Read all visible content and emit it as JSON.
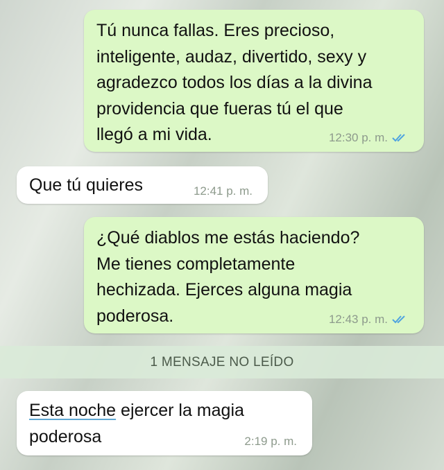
{
  "messages": [
    {
      "direction": "outgoing",
      "text": "Tú nunca fallas. Eres precioso,\ninteligente, audaz, divertido, sexy y\nagradezco todos los días a la divina\nprovidencia que fueras tú el que\nllegó a mi vida.",
      "time": "12:30 p. m.",
      "status_icon": "double-check-read-icon"
    },
    {
      "direction": "incoming",
      "text": "Que tú quieres",
      "time": "12:41 p. m."
    },
    {
      "direction": "outgoing",
      "text": "¿Qué diablos me estás haciendo?\nMe tienes completamente\nhechizada. Ejerces alguna magia\npoderosa.",
      "time": "12:43 p. m.",
      "status_icon": "double-check-read-icon"
    },
    {
      "direction": "incoming",
      "text_linked": "Esta noche",
      "text_rest": " ejercer la magia\npoderosa",
      "time": "2:19 p. m."
    }
  ],
  "unread_banner": "1 MENSAJE NO LEÍDO",
  "colors": {
    "outgoing_bubble": "#dcf8c6",
    "incoming_bubble": "#ffffff",
    "read_ticks": "#4fa3e0",
    "timestamp": "#8d9a8c"
  }
}
